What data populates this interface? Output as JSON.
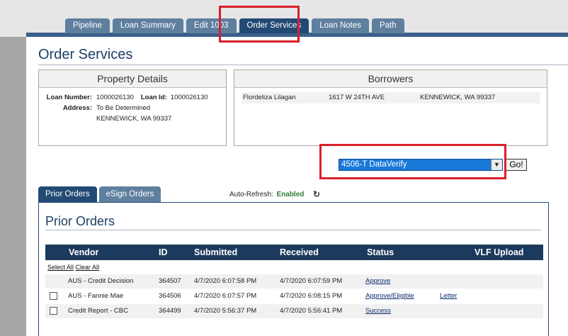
{
  "nav_tabs": [
    {
      "label": "Pipeline",
      "active": false
    },
    {
      "label": "Loan Summary",
      "active": false
    },
    {
      "label": "Edit 1003",
      "active": false
    },
    {
      "label": "Order Services",
      "active": true
    },
    {
      "label": "Loan Notes",
      "active": false
    },
    {
      "label": "Path",
      "active": false
    }
  ],
  "page_title": "Order Services",
  "property_details": {
    "heading": "Property Details",
    "loan_number_label": "Loan Number:",
    "loan_number": "1000026130",
    "loan_id_label": "Loan Id:",
    "loan_id": "1000026130",
    "address_label": "Address:",
    "address_line1": "To Be Determined",
    "address_line2": "KENNEWICK, WA 99337"
  },
  "borrowers": {
    "heading": "Borrowers",
    "rows": [
      {
        "name": "Flordeliza Lilagan",
        "street": "1617 W 24TH AVE",
        "city": "KENNEWICK, WA 99337"
      }
    ]
  },
  "service_select": {
    "value": "4506-T DataVerify",
    "go_label": "Go!"
  },
  "sub_tabs": [
    {
      "label": "Prior Orders",
      "active": true
    },
    {
      "label": "eSign Orders",
      "active": false
    }
  ],
  "auto_refresh": {
    "label": "Auto-Refresh:",
    "status": "Enabled"
  },
  "prior_orders": {
    "title": "Prior Orders",
    "columns": [
      "Vendor",
      "ID",
      "Submitted",
      "Received",
      "Status",
      "VLF Upload"
    ],
    "select_all": "Select All",
    "clear_all": "Clear All",
    "rows": [
      {
        "vendor": "AUS - Credit Decision",
        "id": "364507",
        "submitted": "4/7/2020 6:07:58 PM",
        "received": "4/7/2020 6:07:59 PM",
        "status": "Approve",
        "extra": "",
        "checkbox": false
      },
      {
        "vendor": "AUS - Fannie Mae",
        "id": "364506",
        "submitted": "4/7/2020 6:07:57 PM",
        "received": "4/7/2020 6:08:15 PM",
        "status": "Approve/Eligible",
        "extra": "Letter",
        "checkbox": true
      },
      {
        "vendor": "Credit Report - CBC",
        "id": "364499",
        "submitted": "4/7/2020 5:56:37 PM",
        "received": "4/7/2020 5:56:41 PM",
        "status": "Success",
        "extra": "",
        "checkbox": true
      }
    ]
  },
  "colors": {
    "nav_active": "#234a74",
    "nav_inactive": "#5f7f9f",
    "highlight": "#d9202a",
    "select_bg": "#1979d8"
  }
}
